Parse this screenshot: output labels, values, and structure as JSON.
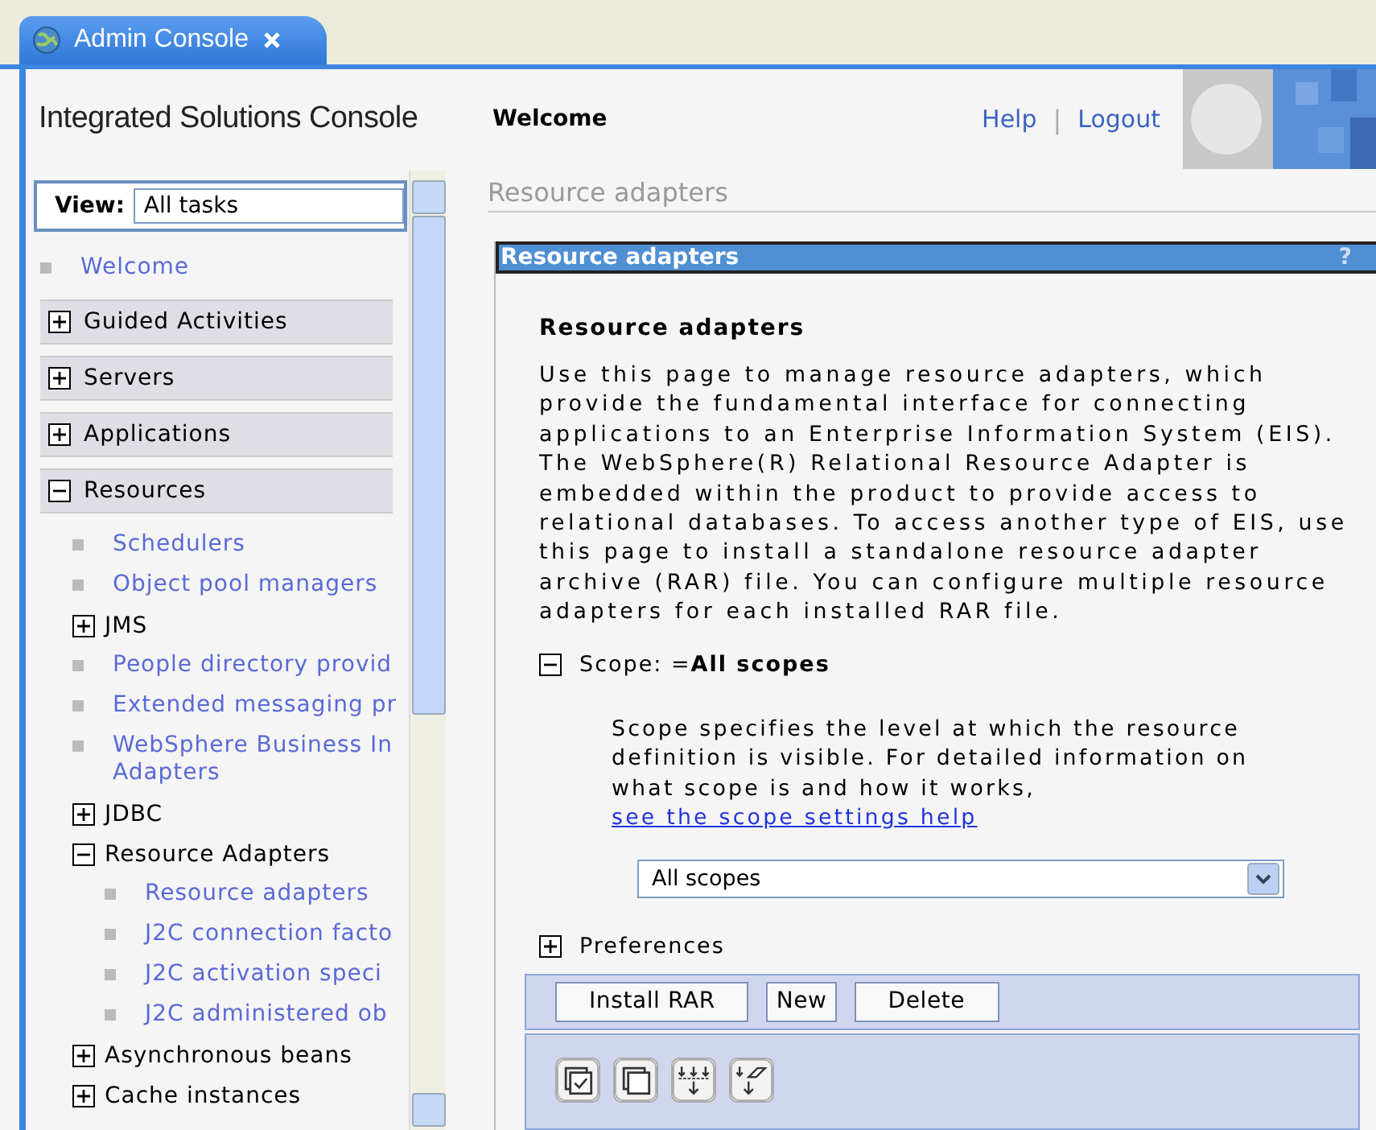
{
  "tab": {
    "label": "Admin Console",
    "selected": true
  },
  "header": {
    "product": "Integrated Solutions Console",
    "page": "Welcome",
    "links": [
      "Help",
      "Logout"
    ],
    "separator": "|"
  },
  "nav": {
    "view_label": "View:",
    "view_value": "All tasks",
    "items": [
      {
        "kind": "link",
        "label": "Welcome"
      },
      {
        "kind": "category",
        "label": "Guided Activities",
        "expanded": false
      },
      {
        "kind": "category",
        "label": "Servers",
        "expanded": false
      },
      {
        "kind": "category",
        "label": "Applications",
        "expanded": false
      },
      {
        "kind": "category",
        "label": "Resources",
        "expanded": true,
        "children": [
          {
            "kind": "link",
            "label": "Schedulers"
          },
          {
            "kind": "link",
            "label": "Object pool managers"
          },
          {
            "kind": "group",
            "label": "JMS",
            "expanded": false
          },
          {
            "kind": "link",
            "label": "People directory provid"
          },
          {
            "kind": "link",
            "label": "Extended messaging pr"
          },
          {
            "kind": "link",
            "label": "WebSphere Business In\nAdapters"
          },
          {
            "kind": "group",
            "label": "JDBC",
            "expanded": false
          },
          {
            "kind": "group",
            "label": "Resource Adapters",
            "expanded": true,
            "children": [
              {
                "kind": "link",
                "label": "Resource adapters"
              },
              {
                "kind": "link",
                "label": "J2C connection facto"
              },
              {
                "kind": "link",
                "label": "J2C activation speci"
              },
              {
                "kind": "link",
                "label": "J2C administered ob"
              }
            ]
          },
          {
            "kind": "group",
            "label": "Asynchronous beans",
            "expanded": false
          },
          {
            "kind": "group",
            "label": "Cache instances",
            "expanded": false
          }
        ]
      }
    ]
  },
  "content": {
    "breadcrumb": "Resource adapters",
    "panel": {
      "title": "Resource adapters",
      "help": "?",
      "heading": "Resource adapters",
      "description": "Use this page to manage resource adapters, which provide the fundamental interface for connecting applications to an Enterprise Information System (EIS). The WebSphere(R) Relational Resource Adapter is embedded within the product to provide access to relational databases. To access another type of EIS, use this page to install a standalone resource adapter archive (RAR) file. You can configure multiple resource adapters for each installed RAR file.",
      "scope": {
        "label": "Scope: =**All scopes**",
        "expanded": true,
        "text": "Scope specifies the level at which the resource definition is visible. For detailed information on what scope is and how it works, ",
        "link": "see the scope settings help",
        "select_value": "All scopes"
      },
      "preferences": {
        "label": "Preferences",
        "expanded": false
      },
      "buttons": [
        "Install RAR",
        "New",
        "Delete"
      ]
    }
  }
}
